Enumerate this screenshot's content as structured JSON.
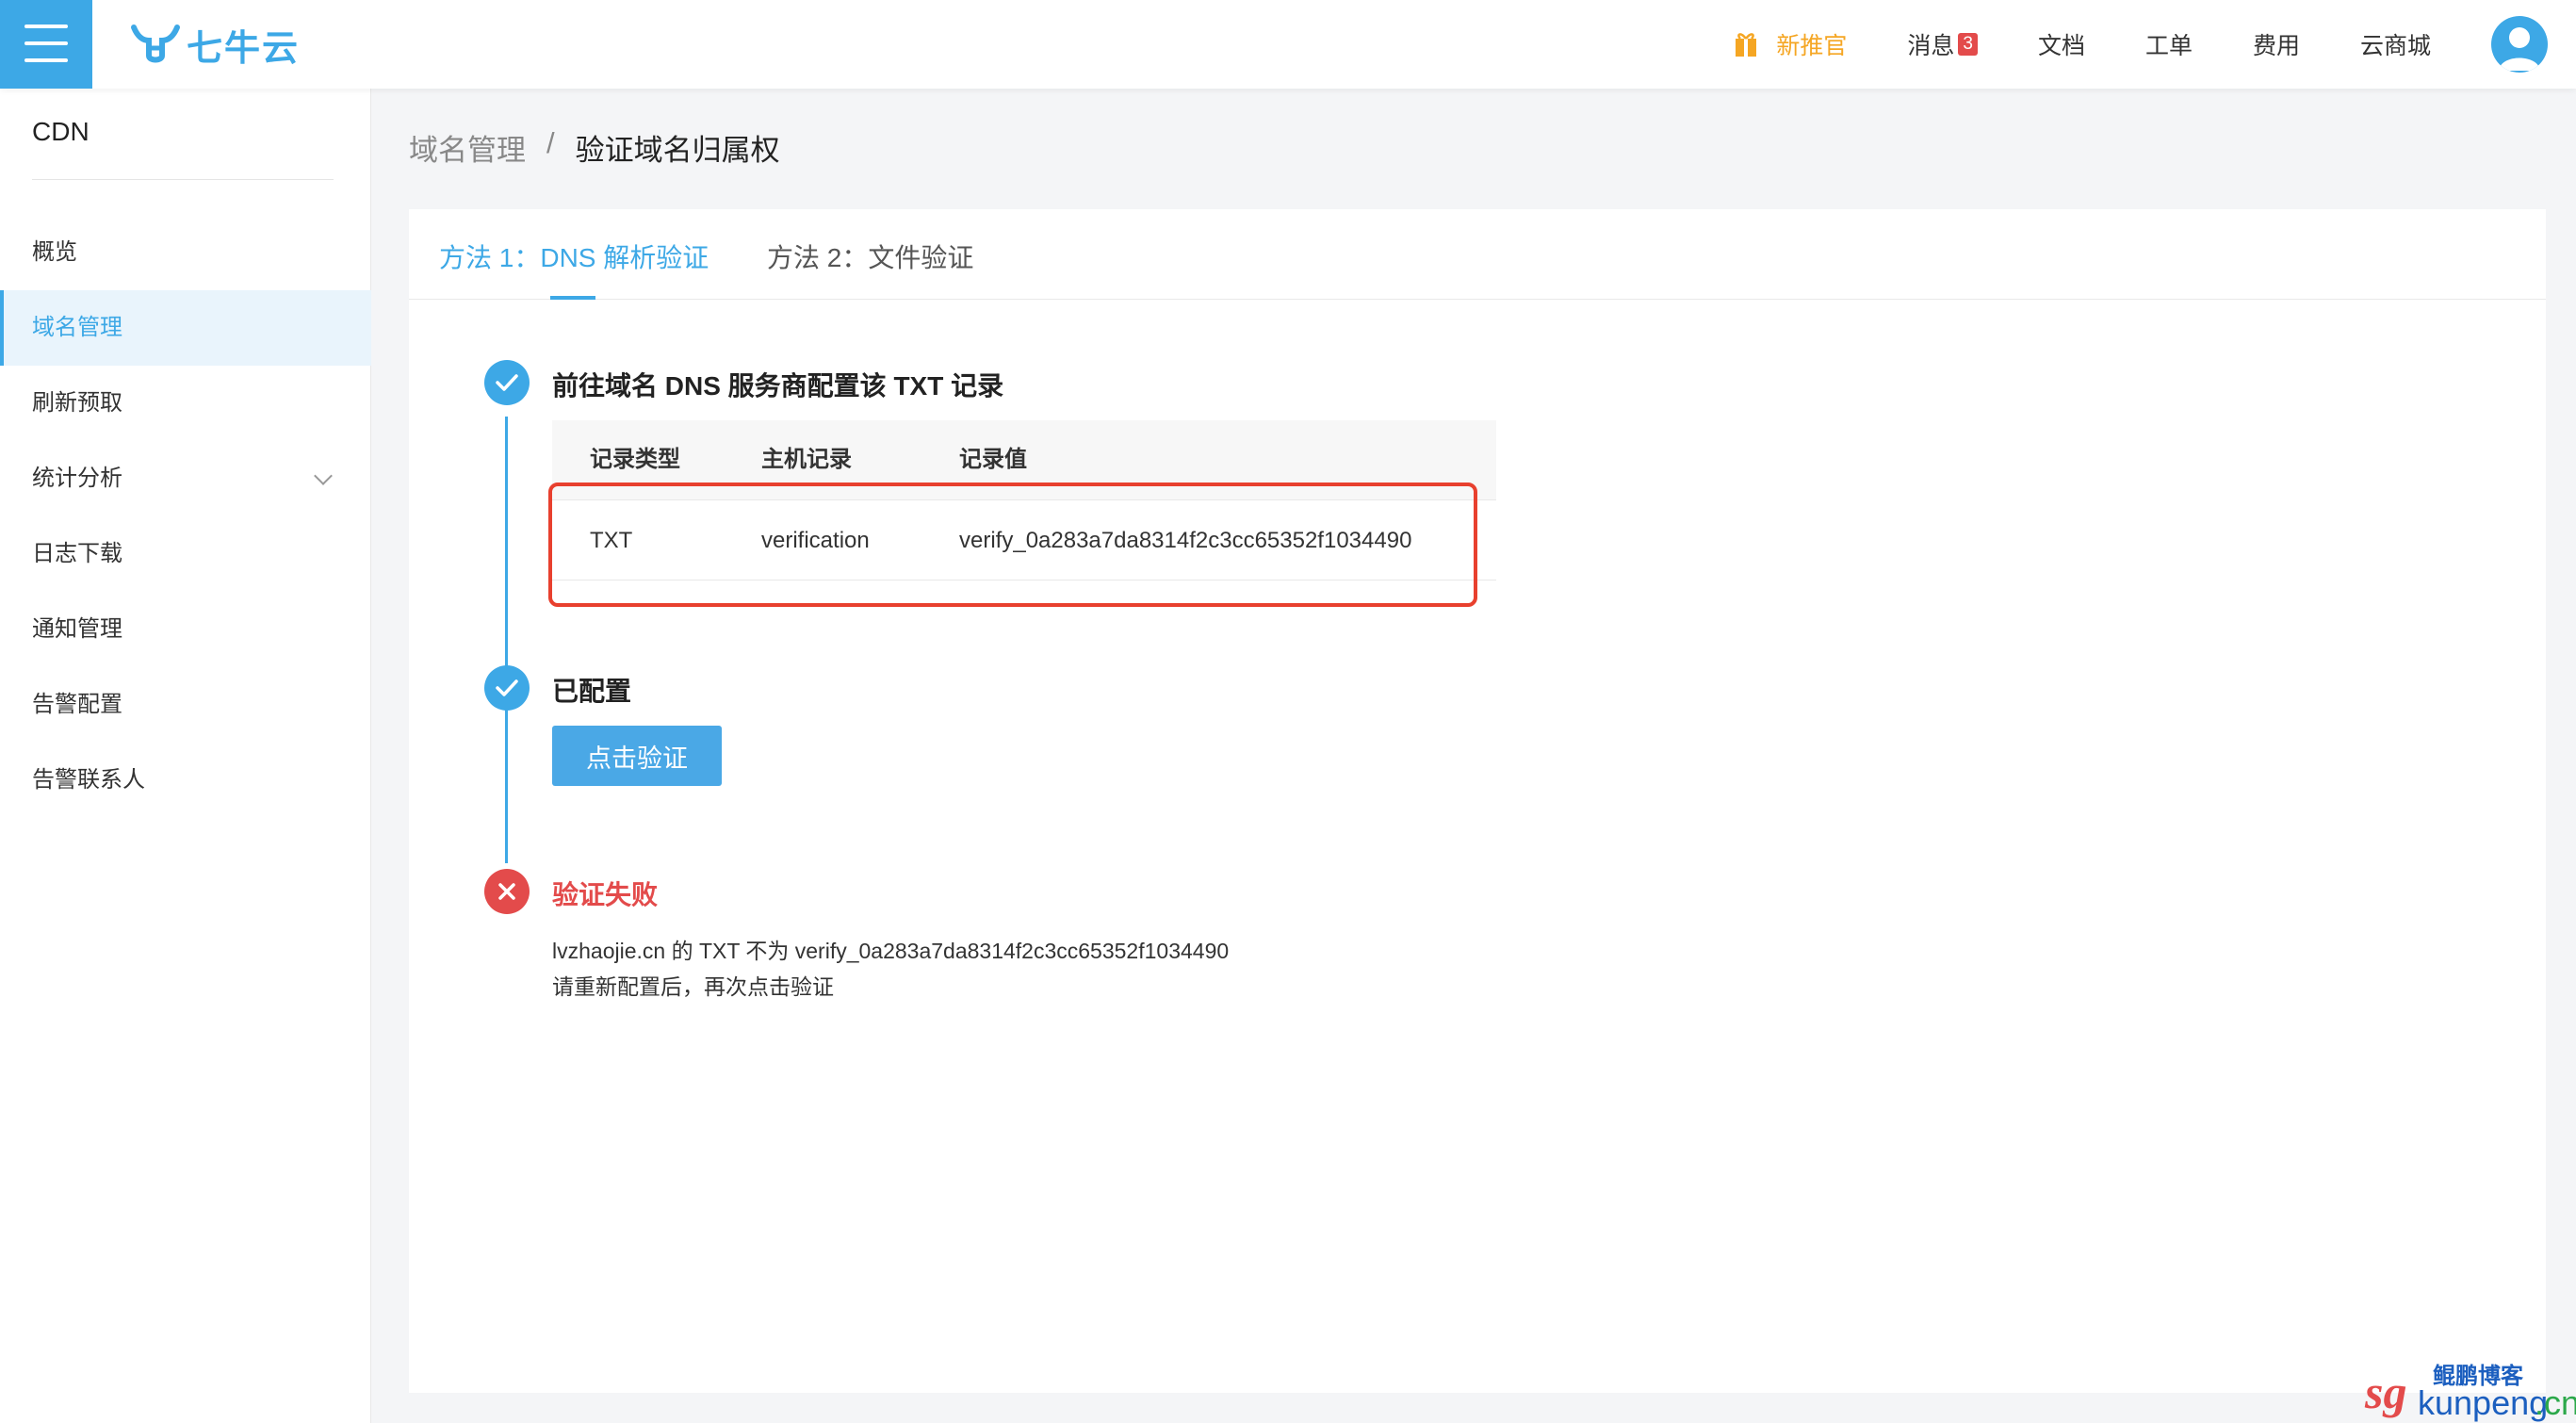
{
  "header": {
    "logo_text": "七牛云",
    "nav": [
      {
        "label": "新推官"
      },
      {
        "label": "消息",
        "badge": "3"
      },
      {
        "label": "文档"
      },
      {
        "label": "工单"
      },
      {
        "label": "费用"
      },
      {
        "label": "云商城"
      }
    ],
    "colors": {
      "accent": "#3da8e6",
      "promo": "#f5a623",
      "danger": "#e34b4b"
    }
  },
  "sidebar": {
    "title": "CDN",
    "items": [
      {
        "label": "概览"
      },
      {
        "label": "域名管理",
        "active": true
      },
      {
        "label": "刷新预取"
      },
      {
        "label": "统计分析",
        "expandable": true
      },
      {
        "label": "日志下载"
      },
      {
        "label": "通知管理"
      },
      {
        "label": "告警配置"
      },
      {
        "label": "告警联系人"
      }
    ]
  },
  "breadcrumb": {
    "parent": "域名管理",
    "separator": "/",
    "current": "验证域名归属权"
  },
  "tabs": [
    {
      "label": "方法 1：DNS 解析验证",
      "active": true
    },
    {
      "label": "方法 2：文件验证"
    }
  ],
  "steps": {
    "step1": {
      "title": "前往域名 DNS 服务商配置该 TXT 记录",
      "table": {
        "headers": [
          "记录类型",
          "主机记录",
          "记录值"
        ],
        "row": [
          "TXT",
          "verification",
          "verify_0a283a7da8314f2c3cc65352f1034490"
        ]
      }
    },
    "step2": {
      "title": "已配置",
      "button_label": "点击验证"
    },
    "step3": {
      "title": "验证失败",
      "message_line1": "lvzhaojie.cn 的 TXT 不为 verify_0a283a7da8314f2c3cc65352f1034490",
      "message_line2": "请重新配置后，再次点击验证"
    }
  },
  "watermark": {
    "prefix": "sg",
    "top_text": "鲲鹏博客",
    "bottom_text": "kunpeng",
    "suffix": ".cn"
  }
}
